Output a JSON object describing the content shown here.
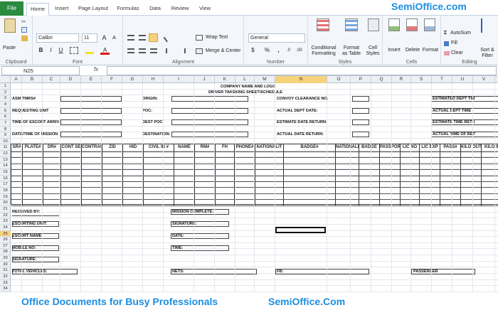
{
  "brand": {
    "top": "SemiOffice.com",
    "bottom": "SemiOffice.Com",
    "slogan": "Office Documents for Busy Professionals"
  },
  "tabs": [
    "File",
    "Home",
    "Insert",
    "Page Layout",
    "Formulas",
    "Data",
    "Review",
    "View"
  ],
  "ribbon": {
    "clipboard": {
      "label": "Clipboard",
      "paste": "Paste"
    },
    "font": {
      "label": "Font",
      "name": "Calibri",
      "size": "11",
      "bold": "B",
      "italic": "I",
      "underline": "U",
      "grow": "A",
      "shrink": "A",
      "color_letter": "A"
    },
    "alignment": {
      "label": "Alignment",
      "wrap_text": "Wrap Text",
      "merge_center": "Merge & Center"
    },
    "number": {
      "label": "Number",
      "format": "General",
      "currency": "$",
      "percent": "%",
      "comma": ",",
      "inc_dec": ".0",
      "dec_dec": ".00"
    },
    "styles": {
      "label": "Styles",
      "conditional": "Conditional",
      "formatting": "Formatting",
      "format_as": "Format",
      "as_table": "as Table",
      "cell": "Cell",
      "cell_styles": "Styles"
    },
    "cells": {
      "label": "Cells",
      "insert": "Insert",
      "delete": "Delete",
      "format": "Format"
    },
    "editing": {
      "label": "Editing",
      "autosum": "AutoSum",
      "fill": "Fill",
      "clear": "Clear",
      "sort": "Sort &",
      "filter": "Filter"
    }
  },
  "formula_bar": {
    "cell_ref": "N25",
    "fx": "fx",
    "content": ""
  },
  "columns": [
    "A",
    "B",
    "C",
    "D",
    "E",
    "F",
    "G",
    "H",
    "I",
    "J",
    "K",
    "L",
    "M",
    "N",
    "O",
    "P",
    "Q",
    "R",
    "S",
    "T",
    "U",
    "V"
  ],
  "rows": [
    "1",
    "2",
    "3",
    "4",
    "5",
    "6",
    "7",
    "8",
    "9",
    "10",
    "11",
    "12",
    "13",
    "14",
    "15",
    "16",
    "17",
    "18",
    "19",
    "20",
    "21",
    "22",
    "23",
    "24",
    "25",
    "26",
    "27",
    "28",
    "29",
    "30",
    "31",
    "32",
    "33",
    "34"
  ],
  "selected_row": "25",
  "form": {
    "title1": "COMPANY NAME AND LOGO",
    "title2": "DRIVER TAKSKING SHEET/SCHEDULE",
    "labels": {
      "asm_tmrs": "ASM TMRS#",
      "requesting_unit": "REQUESTING UNIT",
      "time_escort": "TIME OF ESCORT ARRIV",
      "datetime_mission": "DATE/TIME OF MISSION",
      "origin": "ORIGIN:",
      "poc": "POC:",
      "dest_poc": "DEST POC:",
      "destination": "DESTINATION:",
      "convoy": "CONVOY CLEARANCE NO:",
      "actual_dept_date": "ACTUAL DEPT DATE:",
      "est_date_return": "ESTIMATE DATE RETURN:",
      "actual_date_return": "ACTUAL DATE RETURN:",
      "est_dept_time": "ESTIMATED DEPT TIM",
      "actual_dept_time": "ACTUAL DEPT TIME",
      "est_time_return": "ESTIMATE TIME RETU",
      "actual_time_return": "ACTUAL TIME OF RET",
      "received_by": "RECEIVED BY:",
      "escorting_unit": "ESCORTING UNIT:",
      "escort_name": "ESCORT NAME:",
      "mobile_no": "MOBILE NO:",
      "signature_left": "SIGNATURE:",
      "mission_complete": "MISSION COMPLETE:",
      "signature_right": "SIGNATURE:",
      "date": "DATE:",
      "time": "TIME:",
      "total_vehicles": "TOTAL VEHICLES:",
      "nets": "NETS:",
      "fb": "FB:",
      "passenger": "PASSENGER"
    },
    "table_headers": [
      "SR#",
      "PLATE#",
      "DR#",
      "CONT SE",
      "CONTRAC",
      "ZID",
      "HID",
      "CIVIL ID #",
      "NAME",
      "RM#",
      "FH",
      "PHONE#",
      "NATIONALIT",
      "BADGE#",
      "NATIONALITY",
      "BADGE",
      "PASSPORT",
      "LIC NO",
      "LIC EXP",
      "PASS#",
      "KILO OUT",
      "KILO IN"
    ]
  }
}
